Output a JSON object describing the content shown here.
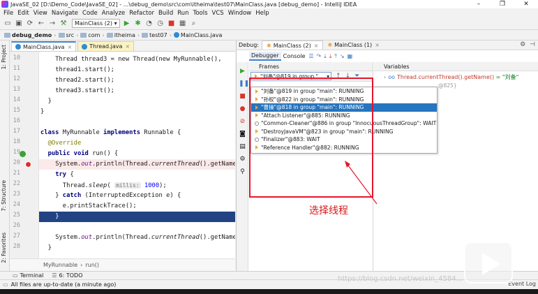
{
  "window": {
    "title": "JavaSE_02 [D:\\Demo_Code\\JavaSE_02] - ...\\debug_demo\\src\\com\\itheima\\test07\\MainClass.java [debug_demo] - IntelliJ IDEA",
    "controls": [
      "–",
      "❐",
      "✕"
    ]
  },
  "menu": [
    "File",
    "Edit",
    "View",
    "Navigate",
    "Code",
    "Analyze",
    "Refactor",
    "Build",
    "Run",
    "Tools",
    "VCS",
    "Window",
    "Help"
  ],
  "toolbar": {
    "run_config": "MainClass (2)"
  },
  "breadcrumbs": [
    "debug_demo",
    "src",
    "com",
    "itheima",
    "test07",
    "MainClass.java"
  ],
  "left_tool_labels": {
    "project": "1: Project",
    "structure": "7: Structure",
    "favorites": "2: Favorites"
  },
  "editor": {
    "tabs": [
      {
        "label": "MainClass.java",
        "close": "×"
      },
      {
        "label": "Thread.java",
        "close": "×"
      }
    ],
    "line_numbers": [
      "10",
      "11",
      "12",
      "13",
      "14",
      "15",
      "16",
      "17",
      "18",
      "19",
      "20",
      "21",
      "22",
      "23",
      "24",
      "25",
      "26",
      "27",
      "28"
    ],
    "code": {
      "l10": "Thread thread3 = new Thread(new MyRunnable(),",
      "l11": "thread1.start();",
      "l12": "thread2.start();",
      "l13": "thread3.start();",
      "l14": "}",
      "l15": "}",
      "l17_kw": "class",
      "l17_rest": " MyRunnable ",
      "l17_kw2": "implements",
      "l17_end": " Runnable {",
      "l18": "@Override",
      "l19_kw": "public void",
      "l19_rest": " run() {",
      "l20_a": "System.",
      "l20_out": "out",
      "l20_b": ".println(Thread.",
      "l20_c": "currentThread",
      "l20_d": "().getName",
      "l21_kw": "try",
      "l21_rest": " {",
      "l22_a": "Thread.",
      "l22_b": "sleep",
      "l22_hint": "millis:",
      "l22_num": "1000",
      "l22_end": ");",
      "l23_a": "} ",
      "l23_kw": "catch",
      "l23_b": " (InterruptedException e) {",
      "l24": "e.printStackTrace();",
      "l25": "}",
      "l26_a": "System.",
      "l26_out": "out",
      "l26_b": ".println(Thread.",
      "l26_c": "currentThread",
      "l26_d": "().getName",
      "l27": "}",
      "l28": "}"
    },
    "breadcrumb_status": {
      "cls": "MyRunnable",
      "method": "run()"
    }
  },
  "debug": {
    "label": "Debug:",
    "tabs": [
      {
        "label": "MainClass (2)",
        "close": "×"
      },
      {
        "label": "MainClass (1)",
        "close": "×"
      }
    ],
    "subtabs": [
      "Debugger",
      "Console"
    ],
    "frames_title": "Frames",
    "variables_title": "Variables",
    "thread_selector": "\"刘备\"@819 in group \"...",
    "variable_expr": "Thread.currentThread().getName()",
    "variable_value": "= \"刘备\"",
    "variable_faded": "@825}",
    "threads": [
      {
        "text": "\"刘备\"@819 in group \"main\": RUNNING",
        "state": "running"
      },
      {
        "text": "\"孙权\"@822 in group \"main\": RUNNING",
        "state": "running"
      },
      {
        "text": "\"曹操\"@818 in group \"main\": RUNNING",
        "state": "running"
      },
      {
        "text": "\"Attach Listener\"@885: RUNNING",
        "state": "running"
      },
      {
        "text": "\"Common-Cleaner\"@886 in group \"InnocuousThreadGroup\": WAIT",
        "state": "wait"
      },
      {
        "text": "\"DestroyJavaVM\"@823 in group \"main\": RUNNING",
        "state": "running"
      },
      {
        "text": "\"Finalizer\"@883: WAIT",
        "state": "wait"
      },
      {
        "text": "\"Reference Handler\"@882: RUNNING",
        "state": "running"
      }
    ],
    "selected_thread_index": 2
  },
  "annotation": {
    "text": "选择线程",
    "color": "#e8142a"
  },
  "bottom_tools": {
    "terminal": "Terminal",
    "todo": "6: TODO"
  },
  "status": {
    "message": "All files are up-to-date (a minute ago)",
    "right": "Event Log"
  },
  "watermark": "https://blog.csdn.net/weixin_4584..."
}
